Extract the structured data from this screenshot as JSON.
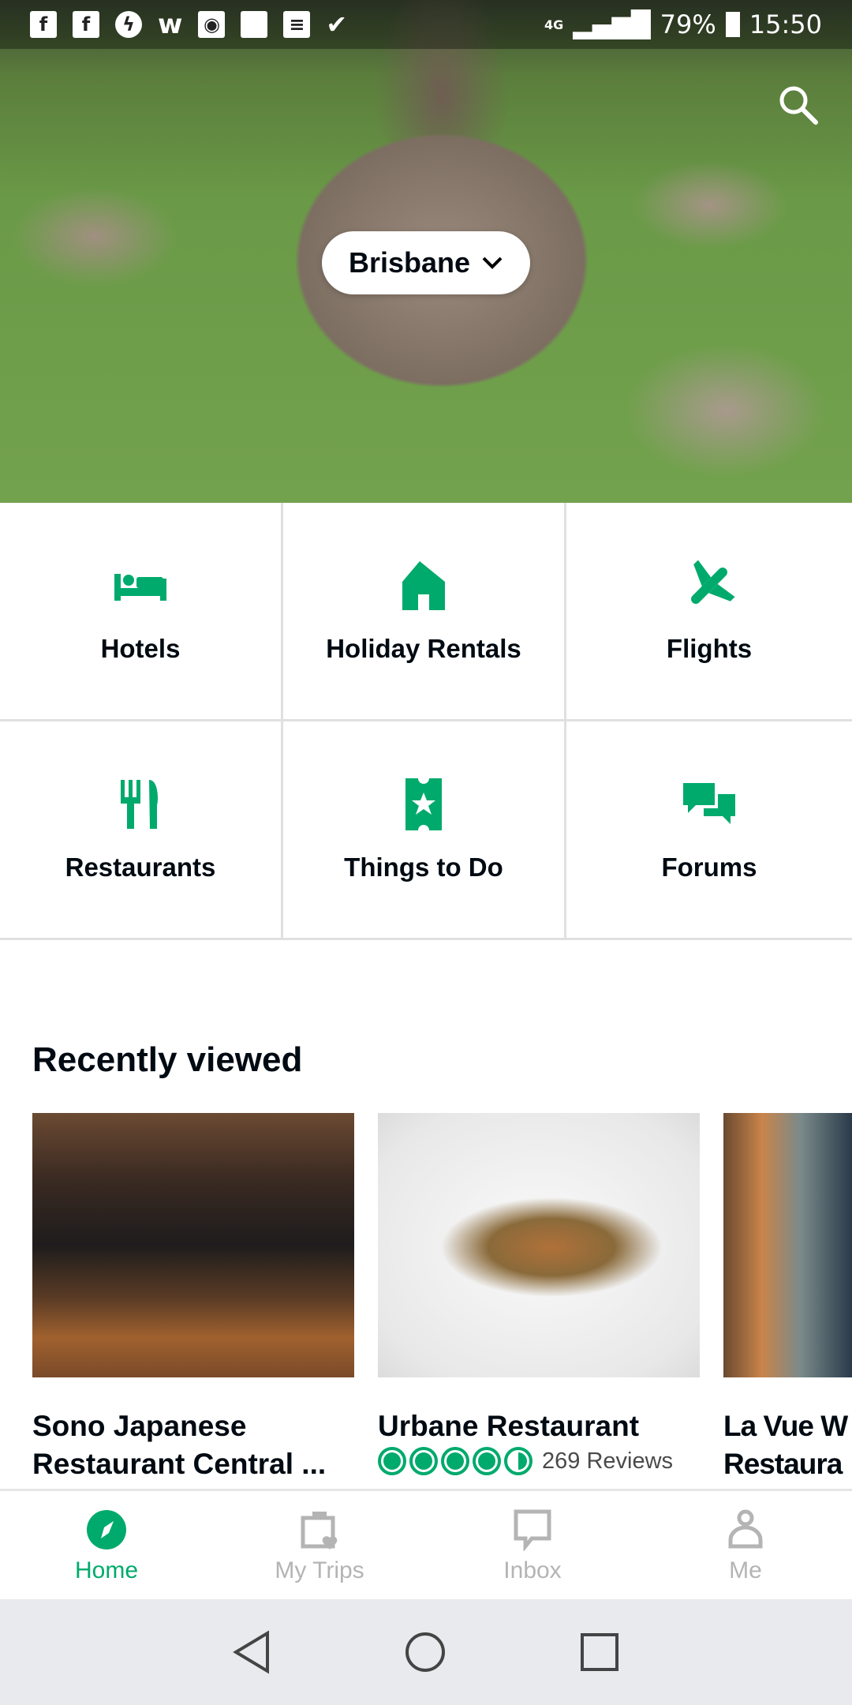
{
  "status_bar": {
    "notification_icons": [
      "facebook-icon",
      "facebook-icon",
      "messenger-icon",
      "wattpad-icon",
      "wifi-hotspot-icon",
      "blank-icon",
      "message-icon",
      "checkmark-icon"
    ],
    "network": "4G",
    "battery": "79%",
    "time": "15:50"
  },
  "header": {
    "city": "Brisbane"
  },
  "categories": [
    {
      "label": "Hotels",
      "icon": "bed-icon"
    },
    {
      "label": "Holiday Rentals",
      "icon": "house-icon"
    },
    {
      "label": "Flights",
      "icon": "plane-icon"
    },
    {
      "label": "Restaurants",
      "icon": "fork-knife-icon"
    },
    {
      "label": "Things to Do",
      "icon": "ticket-icon"
    },
    {
      "label": "Forums",
      "icon": "chat-icon"
    }
  ],
  "recently_viewed": {
    "title": "Recently viewed",
    "items": [
      {
        "title_line1": "Sono Japanese",
        "title_line2": "Restaurant Central ..."
      },
      {
        "title_line1": "Urbane Restaurant",
        "rating": 4.5,
        "reviews": "269 Reviews"
      },
      {
        "title_line1": "La Vue W",
        "title_line2": "Restaura"
      }
    ]
  },
  "bottom_nav": [
    {
      "label": "Home"
    },
    {
      "label": "My Trips"
    },
    {
      "label": "Inbox"
    },
    {
      "label": "Me"
    }
  ],
  "colors": {
    "accent": "#00aa6c",
    "inactive": "#b4b4b4"
  }
}
